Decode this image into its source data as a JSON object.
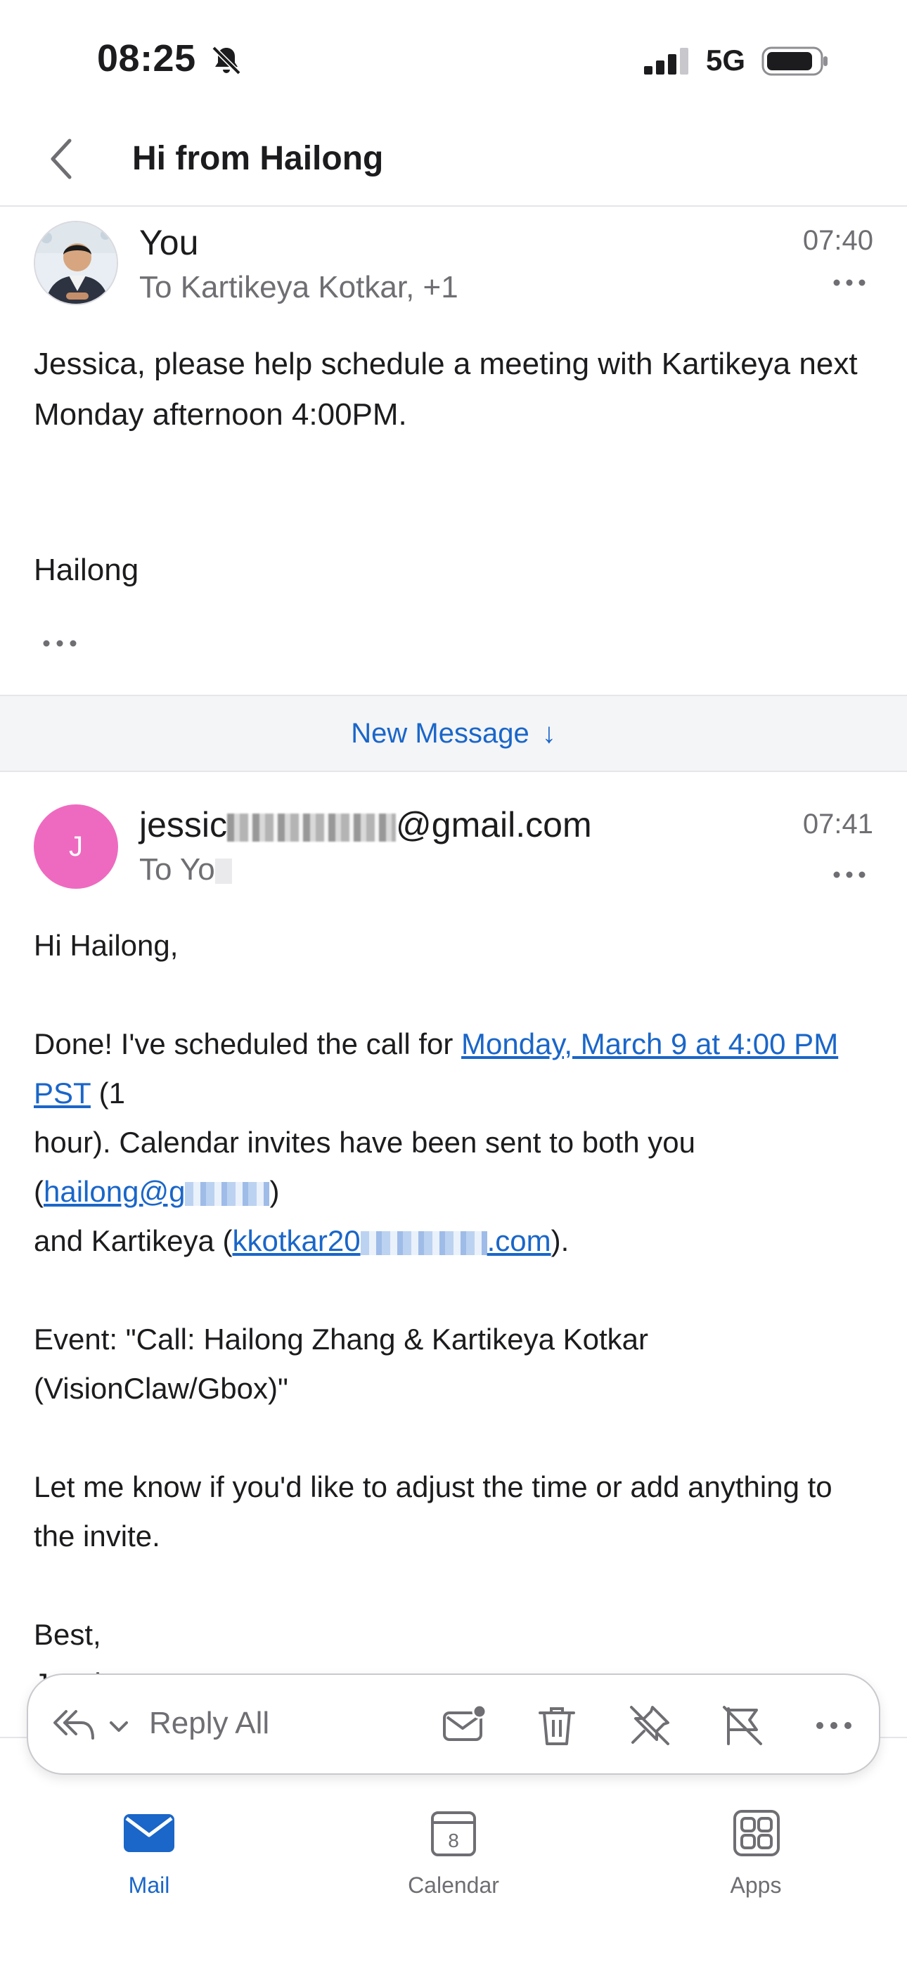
{
  "status": {
    "time": "08:25",
    "network": "5G"
  },
  "nav": {
    "title": "Hi from Hailong"
  },
  "message1": {
    "sender": "You",
    "recipients": "To Kartikeya Kotkar, +1",
    "time": "07:40",
    "body": "Jessica, please help schedule a meeting with Kartikeya next Monday afternoon 4:00PM.",
    "signature": "Hailong"
  },
  "new_message": {
    "label": "New Message",
    "arrow": "↓"
  },
  "message2": {
    "avatar_initial": "J",
    "sender_prefix": "jessic",
    "sender_suffix": "@gmail.com",
    "recipients_prefix": "To Yo",
    "time": "07:41",
    "greeting": "Hi Hailong,",
    "line1_pre": "Done! I've scheduled the call for ",
    "line1_link": "Monday, March 9 at 4:00 PM PST",
    "line1_post": " (1",
    "line2": "hour). Calendar invites have been sent to both you",
    "line3_open": "(",
    "line3_link_prefix": "hailong@g",
    "line3_close": ")",
    "line4_pre": "and Kartikeya (",
    "line4_link_prefix": "kkotkar20",
    "line4_link_suffix": ".com",
    "line4_post": ").",
    "event_line1": "Event: \"Call: Hailong Zhang & Kartikeya Kotkar",
    "event_line2": "(VisionClaw/Gbox)\"",
    "closing_line": "Let me know if you'd like to adjust the time or add anything to the invite.",
    "signoff": "Best,",
    "signature": "Jessica"
  },
  "action_bar": {
    "reply_label": "Reply All"
  },
  "tabs": [
    {
      "label": "Mail"
    },
    {
      "label": "Calendar",
      "date": "8"
    },
    {
      "label": "Apps"
    }
  ],
  "colors": {
    "accent": "#1a66c9",
    "avatar_pink": "#ee6ac0"
  }
}
